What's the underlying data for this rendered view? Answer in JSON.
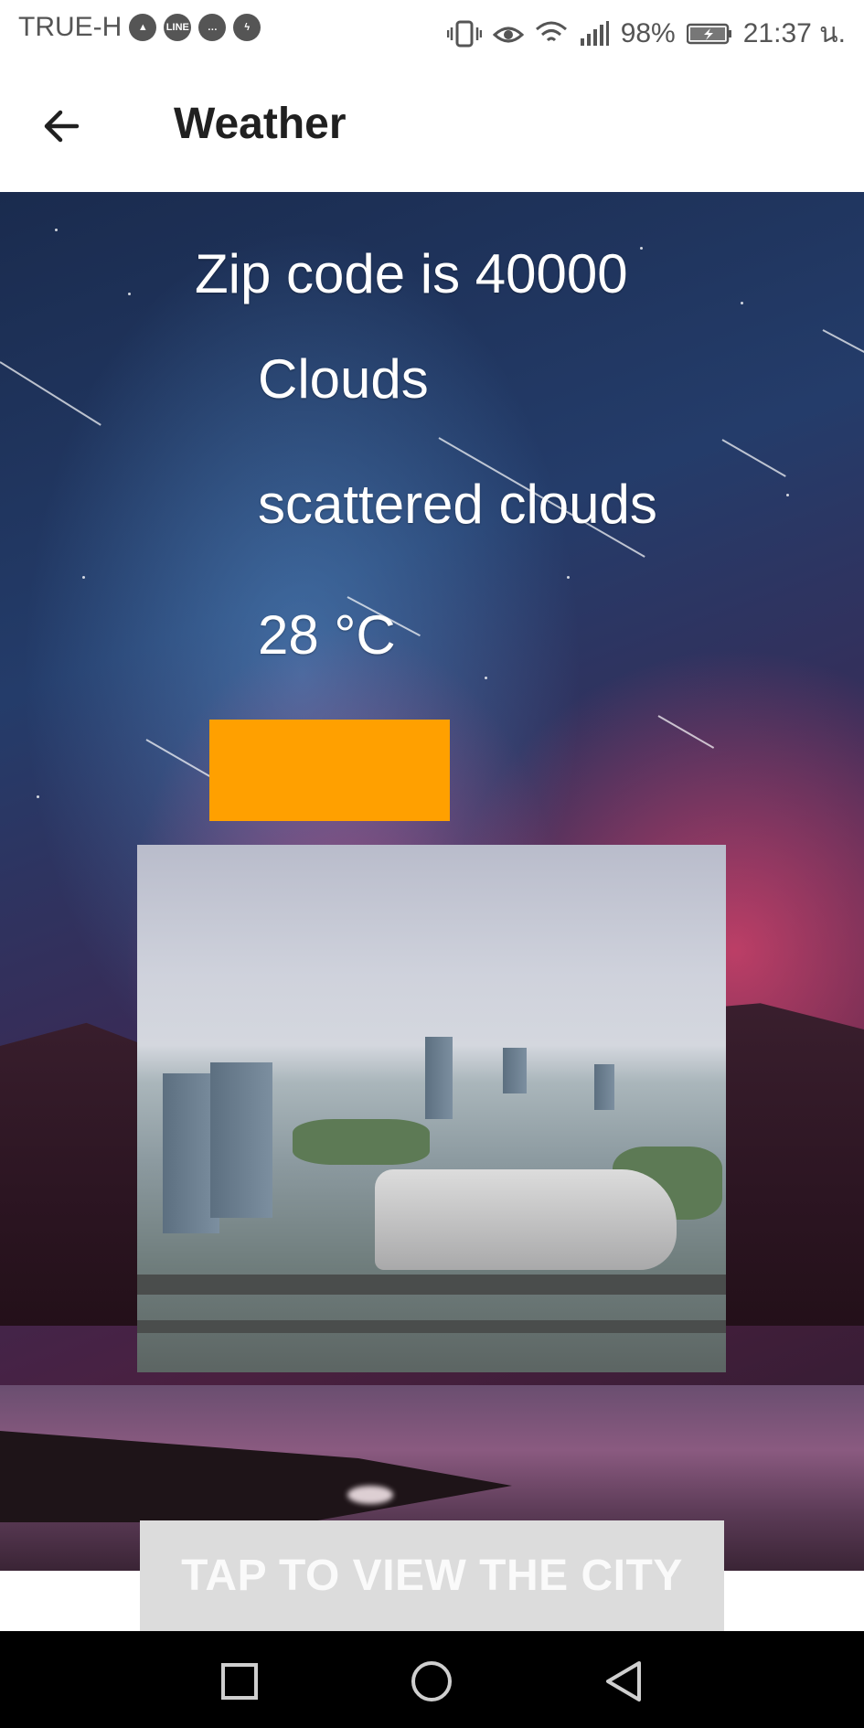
{
  "status_bar": {
    "carrier": "TRUE-H",
    "battery": "98%",
    "time": "21:37 น.",
    "icons": [
      "app-a-icon",
      "line-icon",
      "chat-bubble-icon",
      "messenger-icon",
      "vibrate-icon",
      "eye-icon",
      "wifi-icon",
      "signal-icon",
      "battery-icon"
    ]
  },
  "app_bar": {
    "title": "Weather",
    "back_icon": "arrow-left-icon"
  },
  "weather": {
    "zip_line": "Zip code is 40000",
    "main": "Clouds",
    "description": "scattered clouds",
    "temperature": "28 °C",
    "icon_color": "#ffa000"
  },
  "button": {
    "label": "TAP TO VIEW THE CITY"
  },
  "nav_bar": {
    "icons": [
      "square-icon",
      "circle-icon",
      "triangle-back-icon"
    ]
  }
}
